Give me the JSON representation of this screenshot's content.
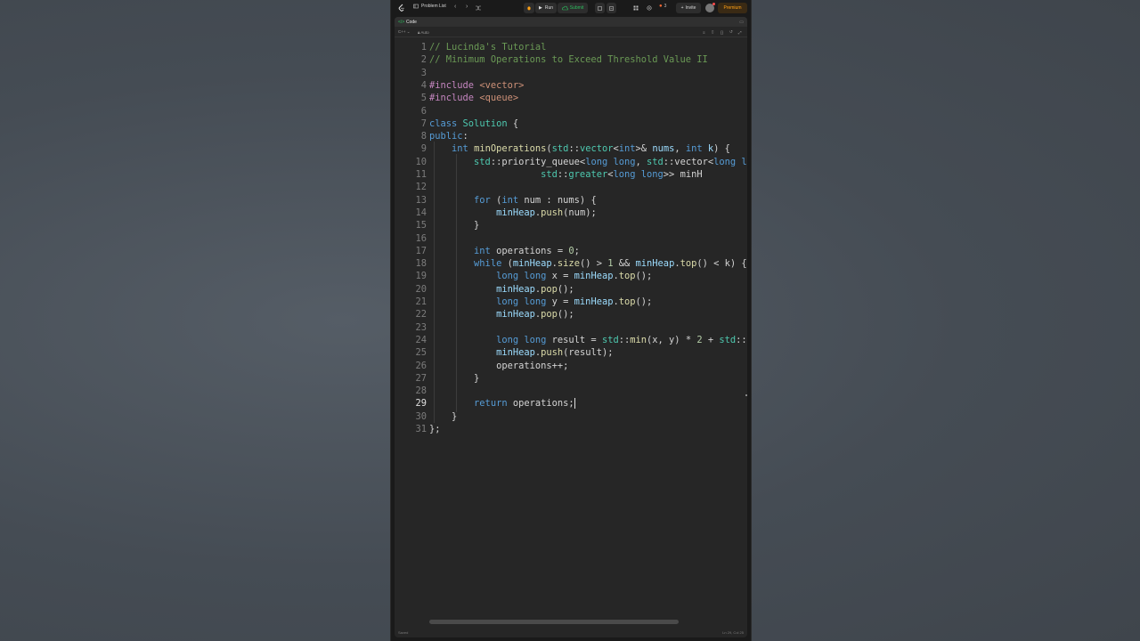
{
  "topbar": {
    "problem_list_label": "Problem List",
    "run_label": "Run",
    "submit_label": "Submit",
    "streak_count": "3",
    "invite_label": "Invite",
    "premium_label": "Premium"
  },
  "panel": {
    "title": "Code",
    "language": "C++",
    "autosave": "Auto"
  },
  "status": {
    "left": "Saved",
    "right": "Ln 29, Col 25"
  },
  "colors": {
    "comment": "#6a9955",
    "preprocessor": "#c586c0",
    "string": "#ce9178",
    "keyword": "#569cd6",
    "type": "#4ec9b0",
    "function": "#dcdcaa",
    "variable": "#9cdcfe",
    "number": "#b5cea8",
    "submit_green": "#2cbb5d",
    "premium_orange": "#ffa116"
  },
  "code_lines": [
    [
      [
        "c",
        "// Lucinda's Tutorial"
      ]
    ],
    [
      [
        "c",
        "// Minimum Operations to Exceed Threshold Value II"
      ]
    ],
    [],
    [
      [
        "p",
        "#include "
      ],
      [
        "s",
        "<vector>"
      ]
    ],
    [
      [
        "p",
        "#include "
      ],
      [
        "s",
        "<queue>"
      ]
    ],
    [],
    [
      [
        "k",
        "class "
      ],
      [
        "t",
        "Solution"
      ],
      [
        "x",
        " {"
      ]
    ],
    [
      [
        "k",
        "public"
      ],
      [
        "x",
        ":"
      ]
    ],
    [
      [
        "x",
        "    "
      ],
      [
        "k",
        "int "
      ],
      [
        "f",
        "minOperations"
      ],
      [
        "x",
        "("
      ],
      [
        "t",
        "std"
      ],
      [
        "x",
        "::"
      ],
      [
        "t",
        "vector"
      ],
      [
        "x",
        "<"
      ],
      [
        "k",
        "int"
      ],
      [
        "x",
        ">& "
      ],
      [
        "v",
        "nums"
      ],
      [
        "x",
        ", "
      ],
      [
        "k",
        "int "
      ],
      [
        "v",
        "k"
      ],
      [
        "x",
        ") {"
      ]
    ],
    [
      [
        "x",
        "        "
      ],
      [
        "t",
        "std"
      ],
      [
        "x",
        "::priority_queue<"
      ],
      [
        "k",
        "long long"
      ],
      [
        "x",
        ", "
      ],
      [
        "t",
        "std"
      ],
      [
        "x",
        "::vector<"
      ],
      [
        "k",
        "long l"
      ]
    ],
    [
      [
        "x",
        "                    "
      ],
      [
        "t",
        "std"
      ],
      [
        "x",
        "::"
      ],
      [
        "t",
        "greater"
      ],
      [
        "x",
        "<"
      ],
      [
        "k",
        "long long"
      ],
      [
        "x",
        ">> minH"
      ]
    ],
    [],
    [
      [
        "x",
        "        "
      ],
      [
        "k",
        "for "
      ],
      [
        "x",
        "("
      ],
      [
        "k",
        "int "
      ],
      [
        "x",
        "num : nums) {"
      ]
    ],
    [
      [
        "x",
        "            "
      ],
      [
        "v",
        "minHeap"
      ],
      [
        "x",
        "."
      ],
      [
        "f",
        "push"
      ],
      [
        "x",
        "(num);"
      ]
    ],
    [
      [
        "x",
        "        }"
      ]
    ],
    [],
    [
      [
        "x",
        "        "
      ],
      [
        "k",
        "int "
      ],
      [
        "x",
        "operations = "
      ],
      [
        "n",
        "0"
      ],
      [
        "x",
        ";"
      ]
    ],
    [
      [
        "x",
        "        "
      ],
      [
        "k",
        "while "
      ],
      [
        "x",
        "("
      ],
      [
        "v",
        "minHeap"
      ],
      [
        "x",
        "."
      ],
      [
        "f",
        "size"
      ],
      [
        "x",
        "() > "
      ],
      [
        "n",
        "1"
      ],
      [
        "x",
        " && "
      ],
      [
        "v",
        "minHeap"
      ],
      [
        "x",
        "."
      ],
      [
        "f",
        "top"
      ],
      [
        "x",
        "() < k) {"
      ]
    ],
    [
      [
        "x",
        "            "
      ],
      [
        "k",
        "long long "
      ],
      [
        "x",
        "x = "
      ],
      [
        "v",
        "minHeap"
      ],
      [
        "x",
        "."
      ],
      [
        "f",
        "top"
      ],
      [
        "x",
        "();"
      ]
    ],
    [
      [
        "x",
        "            "
      ],
      [
        "v",
        "minHeap"
      ],
      [
        "x",
        "."
      ],
      [
        "f",
        "pop"
      ],
      [
        "x",
        "();"
      ]
    ],
    [
      [
        "x",
        "            "
      ],
      [
        "k",
        "long long "
      ],
      [
        "x",
        "y = "
      ],
      [
        "v",
        "minHeap"
      ],
      [
        "x",
        "."
      ],
      [
        "f",
        "top"
      ],
      [
        "x",
        "();"
      ]
    ],
    [
      [
        "x",
        "            "
      ],
      [
        "v",
        "minHeap"
      ],
      [
        "x",
        "."
      ],
      [
        "f",
        "pop"
      ],
      [
        "x",
        "();"
      ]
    ],
    [],
    [
      [
        "x",
        "            "
      ],
      [
        "k",
        "long long "
      ],
      [
        "x",
        "result = "
      ],
      [
        "t",
        "std"
      ],
      [
        "x",
        "::"
      ],
      [
        "f",
        "min"
      ],
      [
        "x",
        "(x, y) * "
      ],
      [
        "n",
        "2"
      ],
      [
        "x",
        " + "
      ],
      [
        "t",
        "std"
      ],
      [
        "x",
        "::"
      ]
    ],
    [
      [
        "x",
        "            "
      ],
      [
        "v",
        "minHeap"
      ],
      [
        "x",
        "."
      ],
      [
        "f",
        "push"
      ],
      [
        "x",
        "(result);"
      ]
    ],
    [
      [
        "x",
        "            operations++;"
      ]
    ],
    [
      [
        "x",
        "        }"
      ]
    ],
    [],
    [
      [
        "x",
        "        "
      ],
      [
        "k",
        "return "
      ],
      [
        "x",
        "operations;"
      ]
    ],
    [
      [
        "x",
        "    }"
      ]
    ],
    [
      [
        "x",
        "};"
      ]
    ]
  ],
  "active_line": 29
}
